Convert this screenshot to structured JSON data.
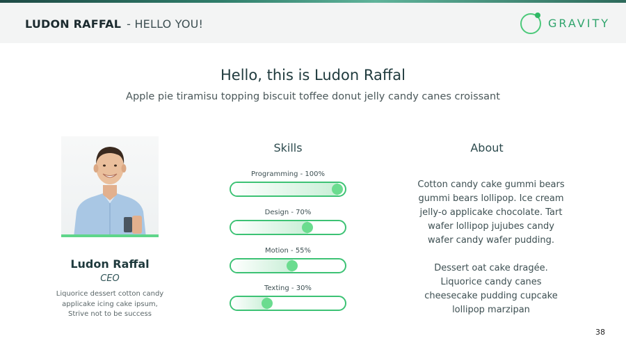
{
  "header": {
    "name": "LUDON RAFFAL",
    "separator": "-",
    "subtitle": "HELLO YOU!",
    "logo_text": "GRAVITY"
  },
  "main": {
    "title": "Hello, this is Ludon Raffal",
    "subtitle": "Apple pie tiramisu topping biscuit toffee donut jelly candy canes croissant"
  },
  "profile": {
    "name": "Ludon Raffal",
    "role": "CEO",
    "description": "Liquorice dessert cotton candy applicake icing cake ipsum, Strive not to be success"
  },
  "skills": {
    "title": "Skills",
    "items": [
      {
        "label": "Programming - 100%",
        "percent": 100
      },
      {
        "label": "Design - 70%",
        "percent": 70
      },
      {
        "label": "Motion - 55%",
        "percent": 55
      },
      {
        "label": "Texting - 30%",
        "percent": 30
      }
    ]
  },
  "about": {
    "title": "About",
    "paragraphs": [
      "Cotton candy cake gummi bears gummi bears lollipop. Ice cream jelly-o applicake chocolate. Tart wafer lollipop jujubes candy wafer candy wafer pudding.",
      "Dessert oat cake dragée. Liquorice candy canes cheesecake pudding cupcake lollipop marzipan"
    ]
  },
  "footer": {
    "page_number": "38"
  },
  "colors": {
    "accent": "#3cc274",
    "brand_text": "#2fa46c",
    "title_text": "#1f3a3d",
    "header_bg": "#f3f4f4"
  }
}
